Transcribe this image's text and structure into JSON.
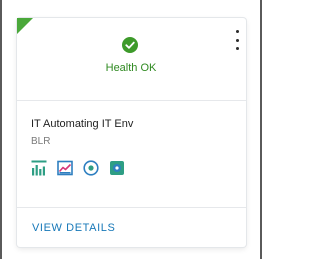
{
  "card": {
    "health": {
      "icon": "check-circle-icon",
      "label": "Health OK",
      "color": "#2f8a21"
    },
    "status_corner_color": "#4aa83a",
    "menu_icon": "kebab-menu-icon",
    "app_name": "IT Automating IT Env",
    "location": "BLR",
    "action_icons": [
      {
        "name": "bar-chart-icon",
        "color": "#2e9e84"
      },
      {
        "name": "line-chart-icon",
        "color": "#2e7fc0"
      },
      {
        "name": "target-icon",
        "color": "#2e7fc0"
      },
      {
        "name": "settings-box-icon",
        "color": "#2e9e84"
      }
    ],
    "view_details_label": "VIEW DETAILS",
    "link_color": "#1778b8"
  }
}
